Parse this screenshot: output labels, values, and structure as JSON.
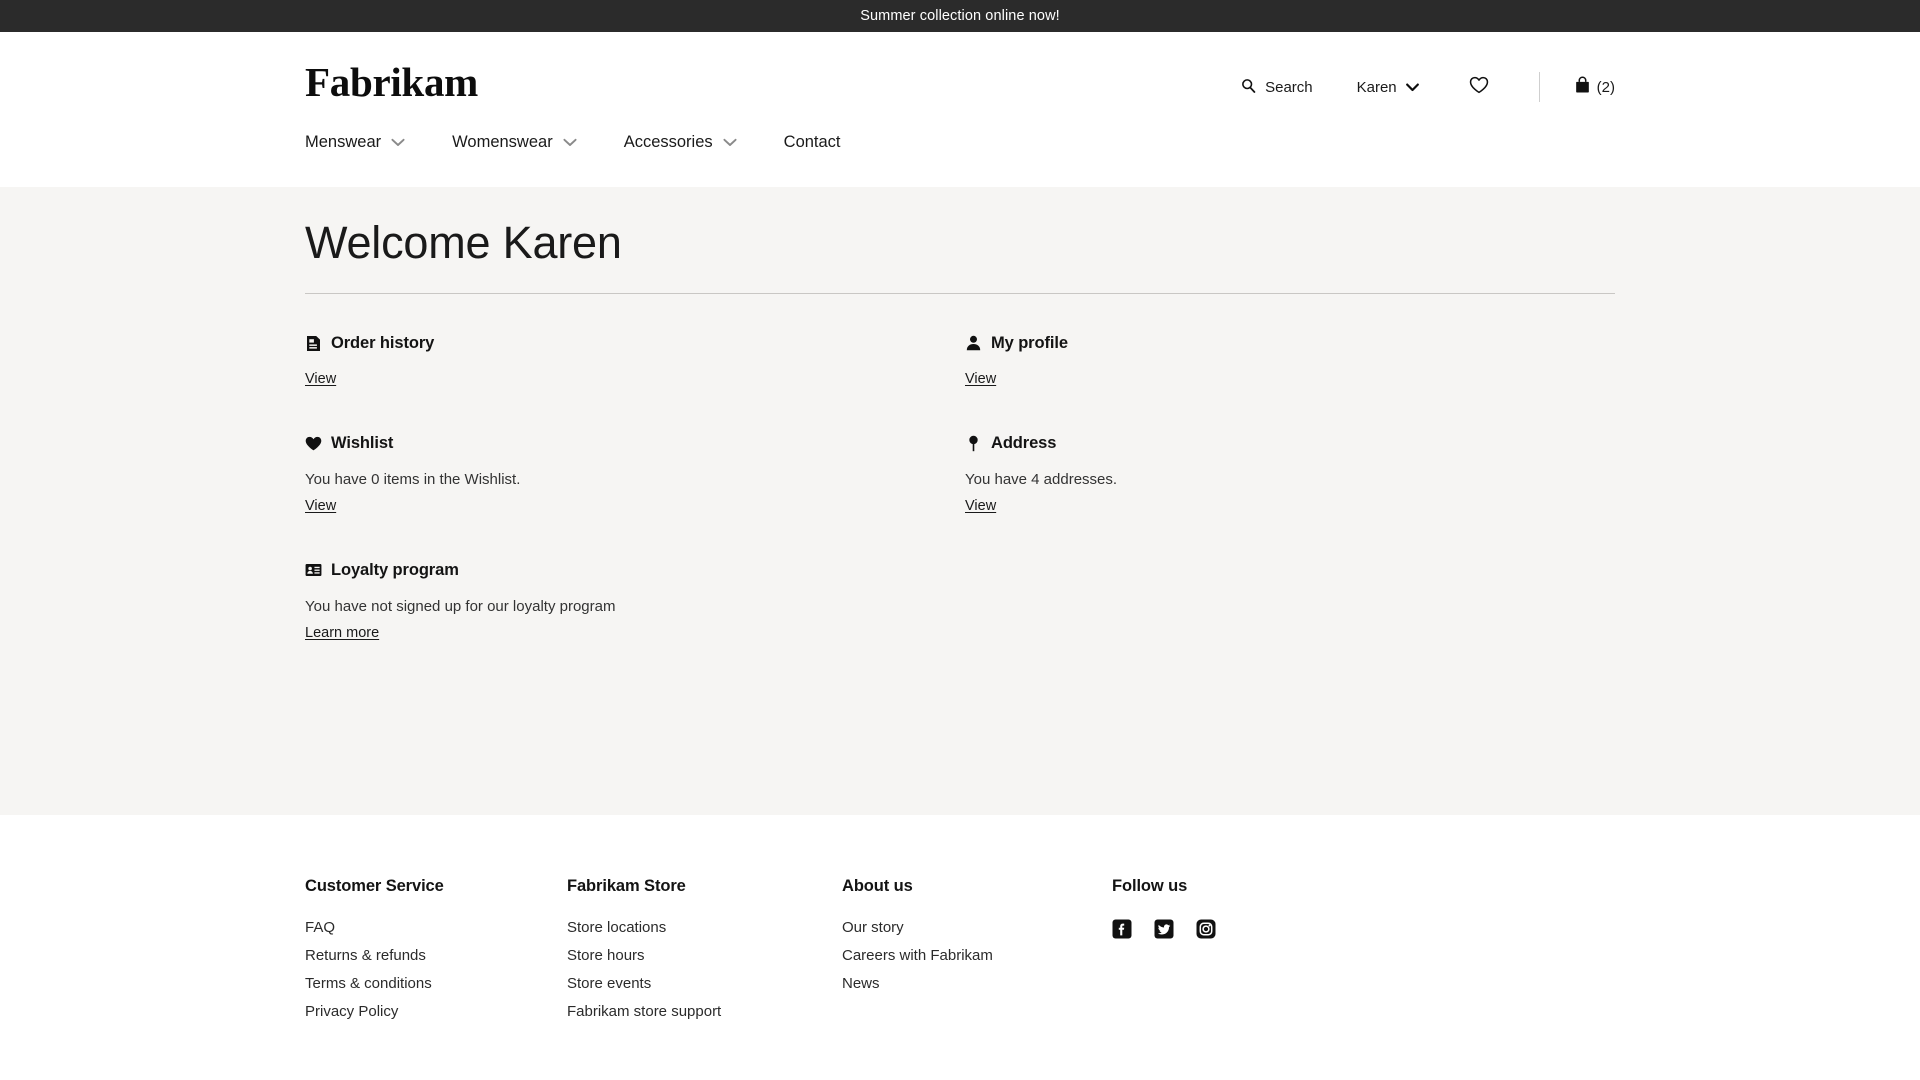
{
  "announcement": {
    "text": "Summer collection online now!"
  },
  "header": {
    "logo": "Fabrikam",
    "actions": {
      "search_label": "Search",
      "account_label": "Karen",
      "bag_count": "(2)"
    },
    "nav": [
      {
        "label": "Menswear",
        "has_dropdown": true
      },
      {
        "label": "Womenswear",
        "has_dropdown": true
      },
      {
        "label": "Accessories",
        "has_dropdown": true
      },
      {
        "label": "Contact",
        "has_dropdown": false
      }
    ]
  },
  "main": {
    "title": "Welcome Karen",
    "cards": [
      {
        "title": "Order history",
        "icon": "document-icon",
        "description": "",
        "link": "View"
      },
      {
        "title": "My profile",
        "icon": "person-icon",
        "description": "",
        "link": "View"
      },
      {
        "title": "Wishlist",
        "icon": "heart-filled-icon",
        "description": "You have 0 items in the Wishlist.",
        "link": "View"
      },
      {
        "title": "Address",
        "icon": "map-pin-icon",
        "description": "You have 4 addresses.",
        "link": "View"
      },
      {
        "title": "Loyalty program",
        "icon": "id-card-icon",
        "description": "You have not signed up for our loyalty program",
        "link": "Learn more"
      }
    ]
  },
  "footer": {
    "columns": [
      {
        "title": "Customer Service",
        "links": [
          "FAQ",
          "Returns & refunds",
          "Terms & conditions",
          "Privacy Policy"
        ]
      },
      {
        "title": "Fabrikam Store",
        "links": [
          "Store locations",
          "Store hours",
          "Store events",
          "Fabrikam store support"
        ]
      },
      {
        "title": "About us",
        "links": [
          "Our story",
          "Careers with Fabrikam",
          "News"
        ]
      }
    ],
    "follow": {
      "title": "Follow us",
      "socials": [
        "facebook-icon",
        "twitter-icon",
        "instagram-icon"
      ]
    }
  },
  "colors": {
    "announce_bg": "#2b2b2b",
    "content_bg": "#f6f5f3",
    "text": "#1a1a1a",
    "rule": "#c9c7c4"
  }
}
